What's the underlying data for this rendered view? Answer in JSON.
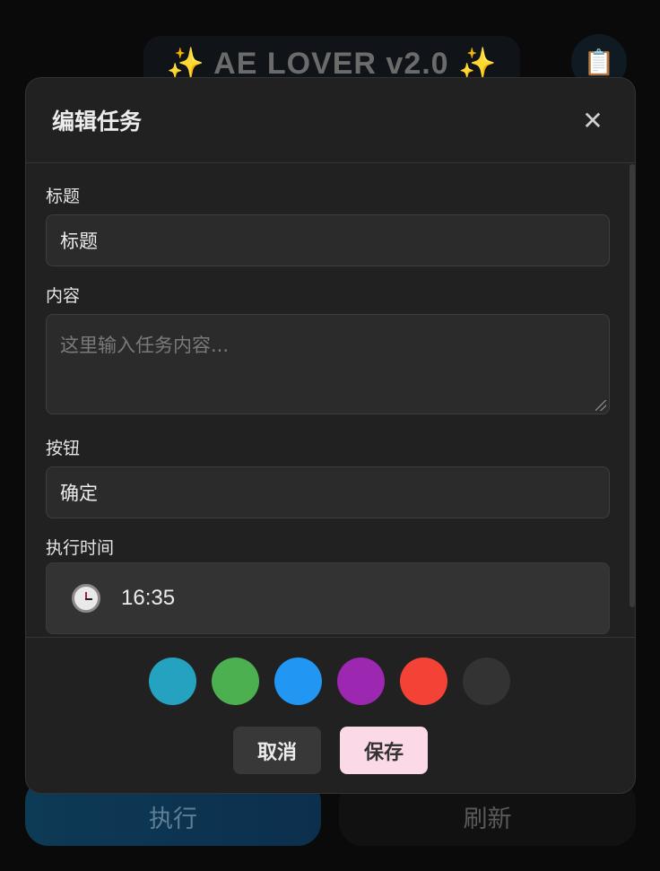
{
  "background": {
    "app_title_left_icon": "✨",
    "app_title": "AE LOVER v2.0",
    "app_title_right_icon": "✨",
    "clipboard_icon": "📋",
    "execute_label": "执行",
    "refresh_label": "刷新"
  },
  "modal": {
    "title": "编辑任务",
    "close_glyph": "✕",
    "fields": {
      "title_label": "标题",
      "title_value": "标题",
      "content_label": "内容",
      "content_placeholder": "这里输入任务内容...",
      "button_label": "按钮",
      "button_value": "确定",
      "time_label": "执行时间",
      "time_value": "16:35"
    },
    "colors": [
      "#26a2c1",
      "#4caf50",
      "#2196f3",
      "#9c27b0",
      "#f44336",
      "#333333"
    ],
    "cancel_label": "取消",
    "save_label": "保存"
  }
}
